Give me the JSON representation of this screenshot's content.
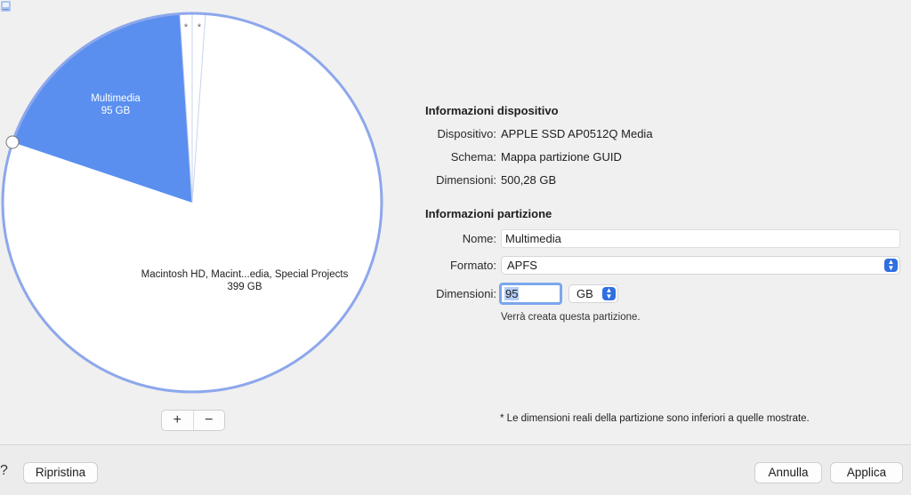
{
  "pie": {
    "multimedia": {
      "name": "Multimedia",
      "size": "95 GB"
    },
    "macintosh": {
      "name": "Macintosh HD, Macint...edia, Special Projects",
      "size": "399 GB"
    },
    "small_marks": [
      "*",
      "*"
    ],
    "colors": {
      "multimedia": "#5a8fef",
      "free": "#ffffff",
      "outline": "#8da7ec"
    }
  },
  "controls": {
    "add": "+",
    "remove": "−"
  },
  "device_info": {
    "title": "Informazioni dispositivo",
    "rows": [
      {
        "label": "Dispositivo:",
        "value": "APPLE SSD AP0512Q Media"
      },
      {
        "label": "Schema:",
        "value": "Mappa partizione GUID"
      },
      {
        "label": "Dimensioni:",
        "value": "500,28 GB"
      }
    ]
  },
  "partition_info": {
    "title": "Informazioni partizione",
    "name_label": "Nome:",
    "name_value": "Multimedia",
    "format_label": "Formato:",
    "format_value": "APFS",
    "size_label": "Dimensioni:",
    "size_value": "95",
    "unit_value": "GB",
    "note": "Verrà creata questa partizione."
  },
  "footnote": "* Le dimensioni reali della partizione sono inferiori a quelle mostrate.",
  "footer": {
    "help": "?",
    "reset": "Ripristina",
    "cancel": "Annulla",
    "apply": "Applica"
  }
}
